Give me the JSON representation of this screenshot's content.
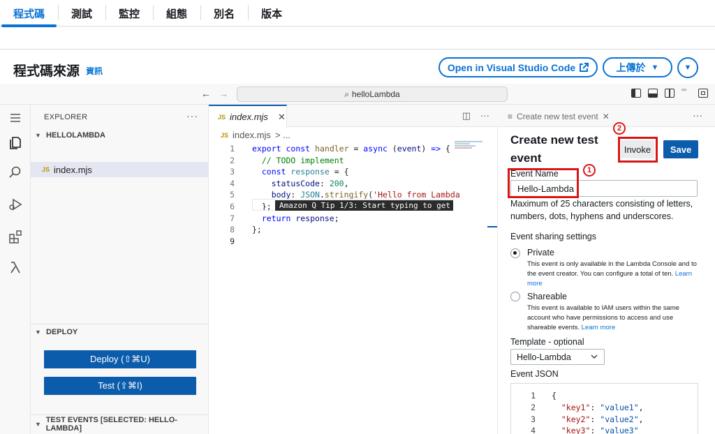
{
  "top_tabs": [
    "程式碼",
    "測試",
    "監控",
    "組態",
    "別名",
    "版本"
  ],
  "panel": {
    "title": "程式碼來源",
    "info": "資訊",
    "open_vscode": "Open in Visual Studio Code",
    "upload": "上傳於",
    "upload_chevron": "▼",
    "more_chevron": "▼"
  },
  "ide": {
    "back": "←",
    "forward": "→",
    "search_icon": "⌕",
    "command_center": "helloLambda",
    "explorer": {
      "title": "EXPLORER",
      "more": "···",
      "folder": "HELLOLAMBDA",
      "file_badge": "JS",
      "file": "index.mjs"
    },
    "deploy": {
      "title": "DEPLOY",
      "deploy_button": "Deploy (⇧⌘U)",
      "test_button": "Test (⇧⌘I)"
    },
    "test_events": {
      "title": "TEST EVENTS [SELECTED: HELLO-LAMBDA]"
    },
    "editor": {
      "tab_badge": "JS",
      "tab_label": "index.mjs",
      "tab_close": "✕",
      "tab_action_split": "◫",
      "tab_action_more": "···",
      "breadcrumb_badge": "JS",
      "breadcrumb_file": "index.mjs",
      "breadcrumb_rest": "> ...",
      "line_numbers": [
        "1",
        "2",
        "3",
        "4",
        "5",
        "6",
        "7",
        "8",
        "9"
      ],
      "q_tip": "Amazon Q Tip 1/3: Start typing to get"
    },
    "test_panel": {
      "tab_label": "Create new test event",
      "tab_close": "✕",
      "more": "···",
      "heading": "Create new test event",
      "invoke": "Invoke",
      "save": "Save",
      "event_name_label": "Event Name",
      "event_name_value": "Hello-Lambda",
      "event_name_hint": "Maximum of 25 characters consisting of letters, numbers, dots, hyphens and underscores.",
      "sharing_label": "Event sharing settings",
      "private_label": "Private",
      "private_desc": "This event is only available in the Lambda Console and to the event creator. You can configure a total of ten.",
      "shareable_label": "Shareable",
      "shareable_desc": "This event is available to IAM users within the same account who have permissions to access and use shareable events.",
      "learn_more": "Learn more",
      "template_label": "Template - optional",
      "template_value": "Hello-Lambda",
      "json_label": "Event JSON",
      "json_line_numbers": [
        "1",
        "2",
        "3",
        "4"
      ],
      "annotation_1": "1",
      "annotation_2": "2"
    }
  },
  "colors": {
    "accent": "#0972d3",
    "primary_button": "#0b5cab",
    "annotation": "#d91515"
  }
}
